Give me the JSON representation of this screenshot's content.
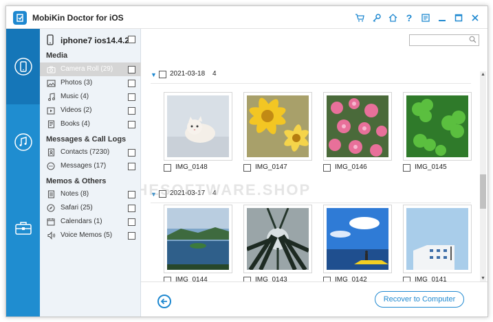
{
  "window": {
    "title": "MobiKin Doctor for iOS"
  },
  "titlebar": {
    "icons": [
      "cart-icon",
      "key-icon",
      "home-icon",
      "help-icon",
      "feedback-icon",
      "minimize-icon",
      "maximize-icon",
      "close-icon"
    ]
  },
  "device": {
    "name": "iphone7 ios14.4.2"
  },
  "sections": {
    "media": "Media",
    "messages": "Messages & Call Logs",
    "memos": "Memos & Others"
  },
  "categories": [
    {
      "label": "Camera Roll",
      "count": "(29)",
      "icon": "camera-icon",
      "selected": true
    },
    {
      "label": "Photos",
      "count": "(3)",
      "icon": "photos-icon"
    },
    {
      "label": "Music",
      "count": "(4)",
      "icon": "music-icon"
    },
    {
      "label": "Videos",
      "count": "(2)",
      "icon": "video-icon"
    },
    {
      "label": "Books",
      "count": "(4)",
      "icon": "book-icon"
    },
    {
      "label": "Contacts",
      "count": "(7230)",
      "icon": "contacts-icon"
    },
    {
      "label": "Messages",
      "count": "(17)",
      "icon": "messages-icon"
    },
    {
      "label": "Notes",
      "count": "(8)",
      "icon": "notes-icon"
    },
    {
      "label": "Safari",
      "count": "(25)",
      "icon": "safari-icon"
    },
    {
      "label": "Calendars",
      "count": "(1)",
      "icon": "calendar-icon"
    },
    {
      "label": "Voice Memos",
      "count": "(5)",
      "icon": "voice-memo-icon"
    }
  ],
  "search": {
    "placeholder": ""
  },
  "groups": [
    {
      "date": "2021-03-18",
      "count": "4",
      "photos": [
        {
          "name": "IMG_0148"
        },
        {
          "name": "IMG_0147"
        },
        {
          "name": "IMG_0146"
        },
        {
          "name": "IMG_0145"
        }
      ]
    },
    {
      "date": "2021-03-17",
      "count": "4",
      "photos": [
        {
          "name": "IMG_0144"
        },
        {
          "name": "IMG_0143"
        },
        {
          "name": "IMG_0142"
        },
        {
          "name": "IMG_0141"
        }
      ]
    }
  ],
  "footer": {
    "recover_label": "Recover to Computer"
  },
  "watermark": "THESOFTWARE.SHOP",
  "colors": {
    "accent": "#1e88d0",
    "rail": "#1f8dd0",
    "rail_active": "#1576b8"
  }
}
